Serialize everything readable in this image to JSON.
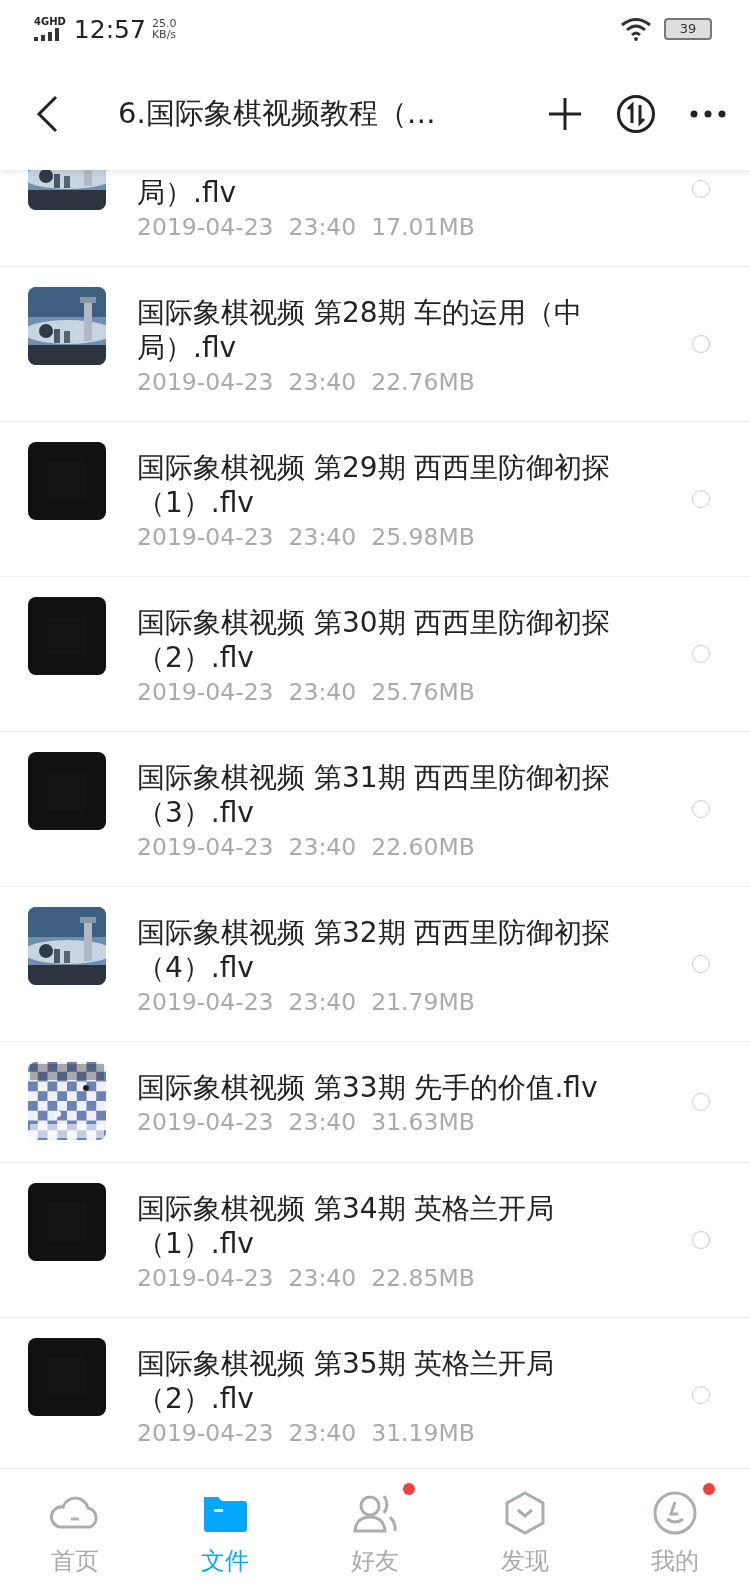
{
  "status_bar": {
    "network": "4G",
    "network_sub": "HD",
    "time": "12:57",
    "speed": "25.0",
    "speed_unit": "KB/s",
    "battery": "39"
  },
  "header": {
    "title": "6.国际象棋视频教程（…"
  },
  "files": [
    {
      "title": "局）.flv",
      "meta": "2019-04-23  23:40  17.01MB",
      "kind": "scene",
      "partial": true,
      "selected": false
    },
    {
      "title": "国际象棋视频 第28期 车的运用（中局）.flv",
      "meta": "2019-04-23  23:40  22.76MB",
      "kind": "scene",
      "partial": false,
      "selected": false
    },
    {
      "title": "国际象棋视频 第29期 西西里防御初探（1）.flv",
      "meta": "2019-04-23  23:40  25.98MB",
      "kind": "dark",
      "partial": false,
      "selected": false
    },
    {
      "title": "国际象棋视频 第30期 西西里防御初探（2）.flv",
      "meta": "2019-04-23  23:40  25.76MB",
      "kind": "dark",
      "partial": false,
      "selected": false
    },
    {
      "title": "国际象棋视频 第31期 西西里防御初探（3）.flv",
      "meta": "2019-04-23  23:40  22.60MB",
      "kind": "dark",
      "partial": false,
      "selected": false
    },
    {
      "title": "国际象棋视频 第32期 西西里防御初探（4）.flv",
      "meta": "2019-04-23  23:40  21.79MB",
      "kind": "scene",
      "partial": false,
      "selected": false
    },
    {
      "title": "国际象棋视频 第33期 先手的价值.flv",
      "meta": "2019-04-23  23:40  31.63MB",
      "kind": "board",
      "partial": false,
      "selected": false
    },
    {
      "title": "国际象棋视频 第34期 英格兰开局（1）.flv",
      "meta": "2019-04-23  23:40  22.85MB",
      "kind": "dark",
      "partial": false,
      "selected": false
    },
    {
      "title": "国际象棋视频 第35期 英格兰开局（2）.flv",
      "meta": "2019-04-23  23:40  31.19MB",
      "kind": "dark",
      "partial": false,
      "selected": false
    }
  ],
  "tabs": [
    {
      "label": "首页",
      "selected": false,
      "badge": false
    },
    {
      "label": "文件",
      "selected": true,
      "badge": false
    },
    {
      "label": "好友",
      "selected": false,
      "badge": true
    },
    {
      "label": "发现",
      "selected": false,
      "badge": false
    },
    {
      "label": "我的",
      "selected": false,
      "badge": true
    }
  ]
}
